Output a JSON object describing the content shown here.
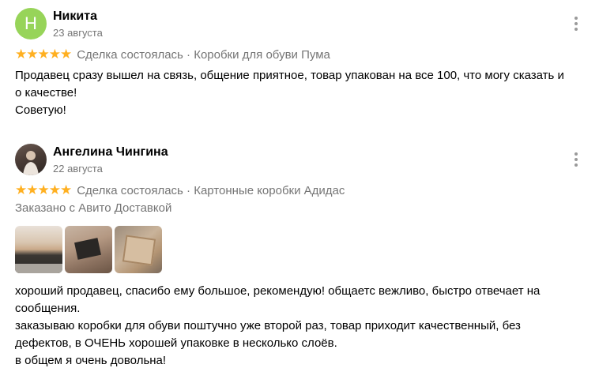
{
  "reviews": [
    {
      "avatar_letter": "Н",
      "name": "Никита",
      "date": "23 августа",
      "stars": "★★★★★",
      "rating": 5,
      "meta": "Сделка состоялась · Коробки для обуви Пума",
      "text_lines": [
        "Продавец сразу вышел на связь, общение приятное, товар упакован на все 100, что могу сказать и",
        "о качестве!",
        "Советую!"
      ],
      "more_icon": "more-vertical-icon"
    },
    {
      "name": "Ангелина Чингина",
      "date": "22 августа",
      "stars": "★★★★★",
      "rating": 5,
      "meta": "Сделка состоялась · Картонные коробки Адидас",
      "delivery": "Заказано с Авито Доставкой",
      "text_lines": [
        "хороший продавец, спасибо ему большое, рекомендую! общаетс вежливо, быстро отвечает на",
        "сообщения.",
        "заказываю коробки для обуви поштучно уже второй раз, товар приходит качественный, без",
        "дефектов, в ОЧЕНЬ хорошей упаковке в несколько слоёв.",
        "в общем я очень довольна!"
      ],
      "more_icon": "more-vertical-icon"
    }
  ],
  "colors": {
    "star": "#ffb021",
    "avatar_green": "#97d459",
    "secondary_text": "#757575"
  }
}
